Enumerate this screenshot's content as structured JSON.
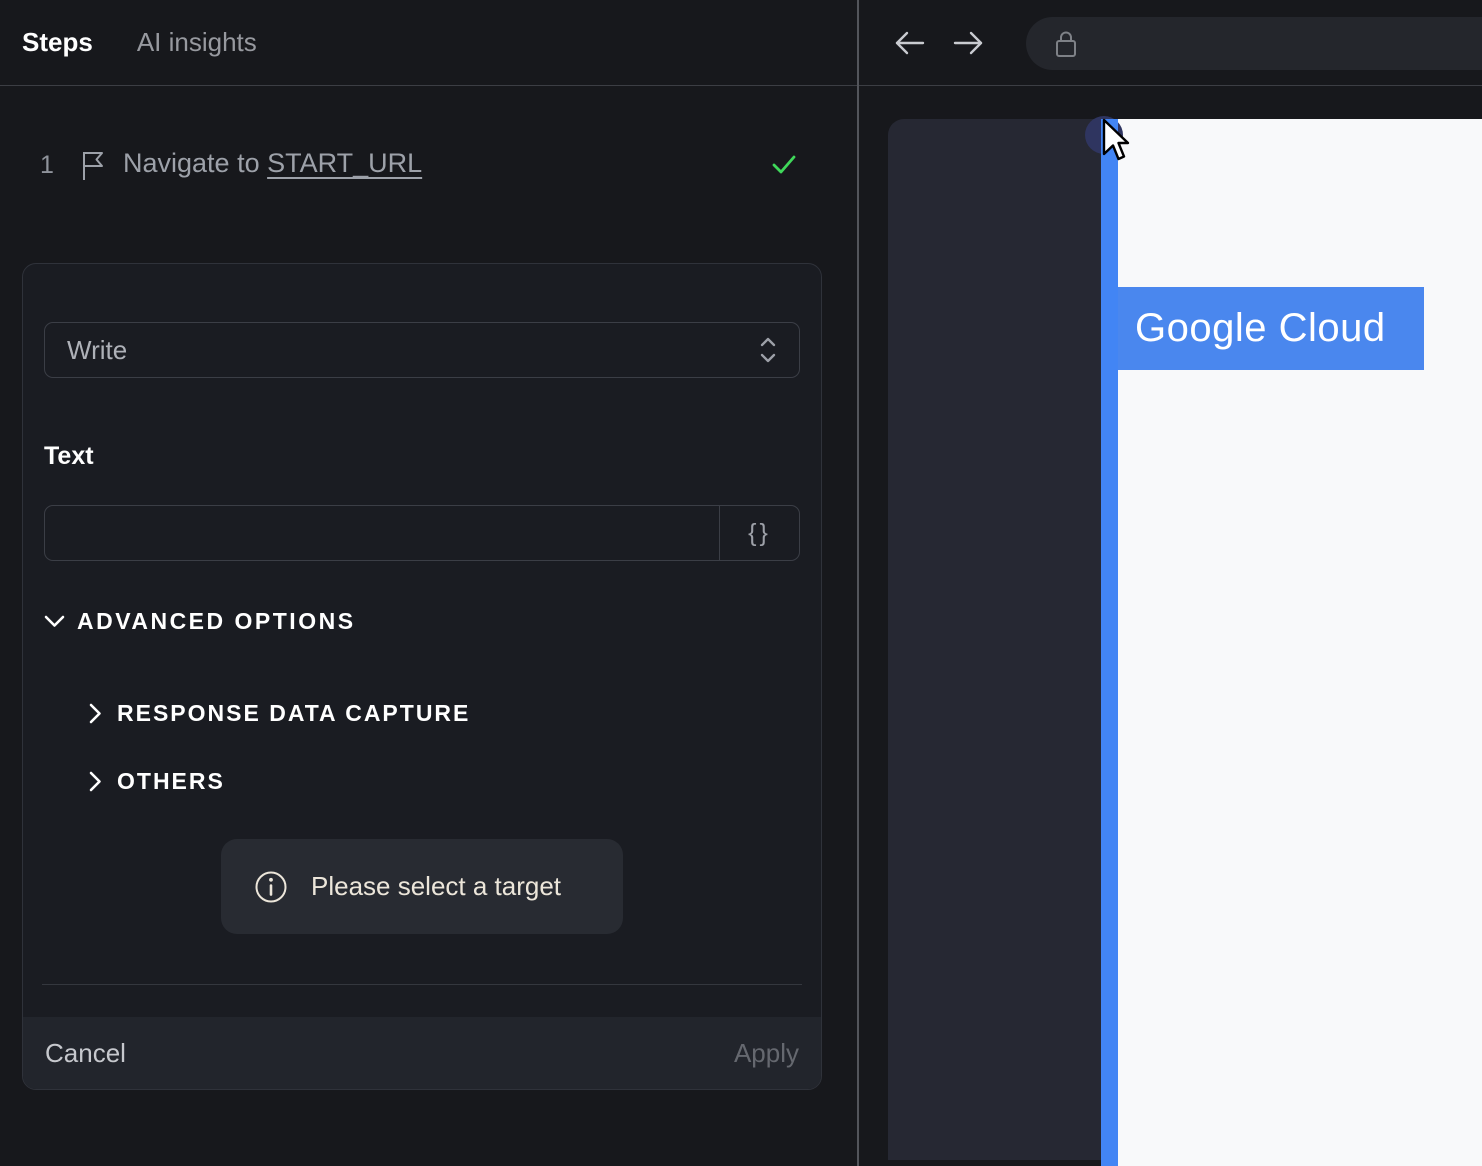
{
  "left_panel": {
    "tabs": [
      {
        "label": "Steps",
        "active": true
      },
      {
        "label": "AI insights",
        "active": false
      }
    ],
    "step": {
      "number": "1",
      "text": "Navigate to",
      "link": "START_URL",
      "status": "success"
    },
    "editor": {
      "action_select": {
        "value": "Write"
      },
      "text_label": "Text",
      "text_input": {
        "value": "",
        "placeholder": ""
      },
      "variable_button_label": "{}",
      "advanced_options_label": "ADVANCED OPTIONS",
      "sections": [
        {
          "label": "RESPONSE DATA CAPTURE"
        },
        {
          "label": "OTHERS"
        }
      ],
      "notice": "Please select a target",
      "cancel_label": "Cancel",
      "apply_label": "Apply"
    }
  },
  "browser": {
    "highlight_label": "Google Cloud"
  },
  "colors": {
    "panel_bg": "#17181c",
    "card_bg": "#1a1c22",
    "card_footer_bg": "#22252c",
    "notice_bg": "#282b32",
    "notice_text": "#ece6da",
    "success_green": "#3fd85a",
    "accent_blue": "#4285f4",
    "highlight_box_blue": "#4a87ee",
    "page_white": "#f8f9fa",
    "sidebar_navy": "#262833",
    "marker_navy": "#2f3560"
  }
}
